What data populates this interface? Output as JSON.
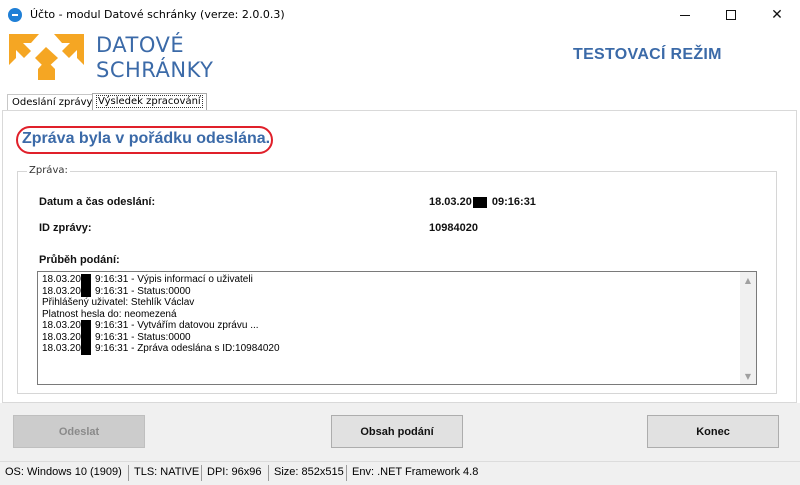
{
  "window": {
    "title": "Účto - modul Datové schránky (verze: 2.0.0.3)",
    "minimize": "—",
    "maximize": "☐",
    "close": "✕"
  },
  "header": {
    "brand_line1": "DATOVÉ",
    "brand_line2": "SCHRÁNKY",
    "mode": "TESTOVACÍ REŽIM",
    "logo_icon": "datove-schranky-logo",
    "logo_color": "#f5a623",
    "brand_color": "#3b6aa8"
  },
  "tabs": [
    {
      "label": "Odeslání zprávy",
      "active": false
    },
    {
      "label": "Výsledek zpracování",
      "active": true
    }
  ],
  "result": {
    "message": "Zpráva byla v pořádku odeslána.",
    "highlight_color": "#e0202a"
  },
  "group": {
    "title": "Zpráva:",
    "sent_label": "Datum a čas odeslání:",
    "sent_date_prefix": "18.03.20",
    "sent_time": "09:16:31",
    "id_label": "ID zprávy:",
    "id_value": "10984020",
    "progress_label": "Průběh podání:"
  },
  "log": [
    {
      "redacted": true,
      "prefix": "18.03.20",
      "text": "9:16:31 - Výpis informací o uživateli"
    },
    {
      "redacted": true,
      "prefix": "18.03.20",
      "text": "9:16:31 - Status:0000"
    },
    {
      "redacted": false,
      "prefix": "",
      "text": "Přihlášený uživatel: Stehlík Václav"
    },
    {
      "redacted": false,
      "prefix": "",
      "text": "Platnost hesla do: neomezená"
    },
    {
      "redacted": true,
      "prefix": "18.03.20",
      "text": "9:16:31 - Vytvářím datovou zprávu ..."
    },
    {
      "redacted": true,
      "prefix": "18.03.20",
      "text": "9:16:31 - Status:0000"
    },
    {
      "redacted": true,
      "prefix": "18.03.20",
      "text": "9:16:31 - Zpráva odeslána s ID:10984020"
    }
  ],
  "buttons": {
    "send": "Odeslat",
    "content": "Obsah podání",
    "end": "Konec"
  },
  "status": {
    "os_label": "OS:",
    "os_value": "Windows 10 (1909)",
    "tls_label": "TLS:",
    "tls_value": "NATIVE",
    "dpi_label": "DPI:",
    "dpi_value": "96x96",
    "size_label": "Size:",
    "size_value": "852x515",
    "env_label": "Env:",
    "env_value": ".NET Framework 4.8"
  }
}
